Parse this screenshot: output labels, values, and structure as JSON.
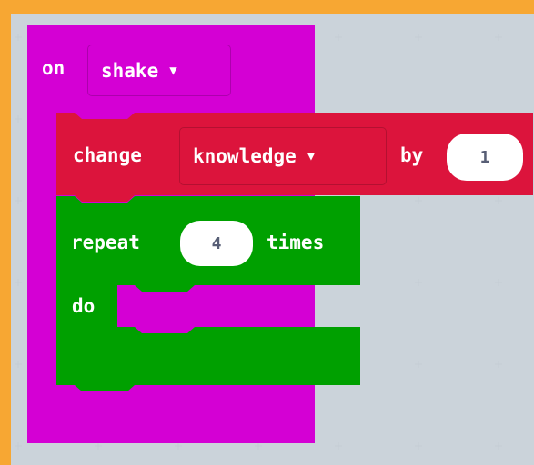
{
  "event_block": {
    "label": "on",
    "dropdown_value": "shake",
    "color": "#D400D4"
  },
  "change_block": {
    "label": "change",
    "variable": "knowledge",
    "by_label": "by",
    "value": "1",
    "color": "#DC143C"
  },
  "repeat_block": {
    "label": "repeat",
    "count": "4",
    "times_label": "times",
    "do_label": "do",
    "color": "#00A000"
  },
  "icons": {
    "dropdown_caret": "chevron-down-icon"
  },
  "colors": {
    "frame": "#F7A733",
    "workspace": "#E9EEF2"
  }
}
